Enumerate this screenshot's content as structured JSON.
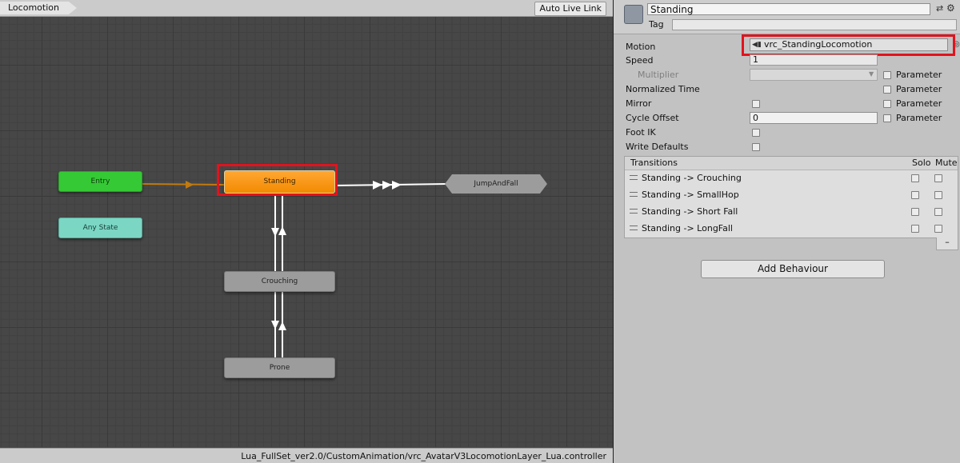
{
  "graph": {
    "breadcrumb": "Locomotion",
    "auto_live_link": "Auto Live Link",
    "nodes": {
      "entry": "Entry",
      "any_state": "Any State",
      "standing": "Standing",
      "crouching": "Crouching",
      "prone": "Prone",
      "jump_and_fall": "JumpAndFall"
    },
    "asset_path": "Lua_FullSet_ver2.0/CustomAnimation/vrc_AvatarV3LocomotionLayer_Lua.controller"
  },
  "inspector": {
    "state_name": "Standing",
    "tag_label": "Tag",
    "tag_value": "",
    "motion_label": "Motion",
    "motion_value": "vrc_StandingLocomotion",
    "speed_label": "Speed",
    "speed_value": "1",
    "multiplier_label": "Multiplier",
    "normalized_time_label": "Normalized Time",
    "mirror_label": "Mirror",
    "cycle_offset_label": "Cycle Offset",
    "cycle_offset_value": "0",
    "foot_ik_label": "Foot IK",
    "write_defaults_label": "Write Defaults",
    "parameter_label": "Parameter",
    "transitions": {
      "title": "Transitions",
      "solo_label": "Solo",
      "mute_label": "Mute",
      "items": [
        {
          "label": "Standing -> Crouching"
        },
        {
          "label": "Standing -> SmallHop"
        },
        {
          "label": "Standing -> Short Fall"
        },
        {
          "label": "Standing -> LongFall"
        }
      ],
      "remove_label": "–"
    },
    "add_behaviour_label": "Add Behaviour"
  },
  "icons": {
    "help": "help-icon",
    "settings": "gear-icon",
    "motion": "animation-clip-icon",
    "object_picker": "object-picker-icon"
  },
  "colors": {
    "selected_state": "#f28a00",
    "entry_state": "#35c935",
    "any_state": "#7cd6c4",
    "default_state": "#9c9c9c",
    "highlight": "#e0141e",
    "entry_transition": "#c07a10"
  }
}
